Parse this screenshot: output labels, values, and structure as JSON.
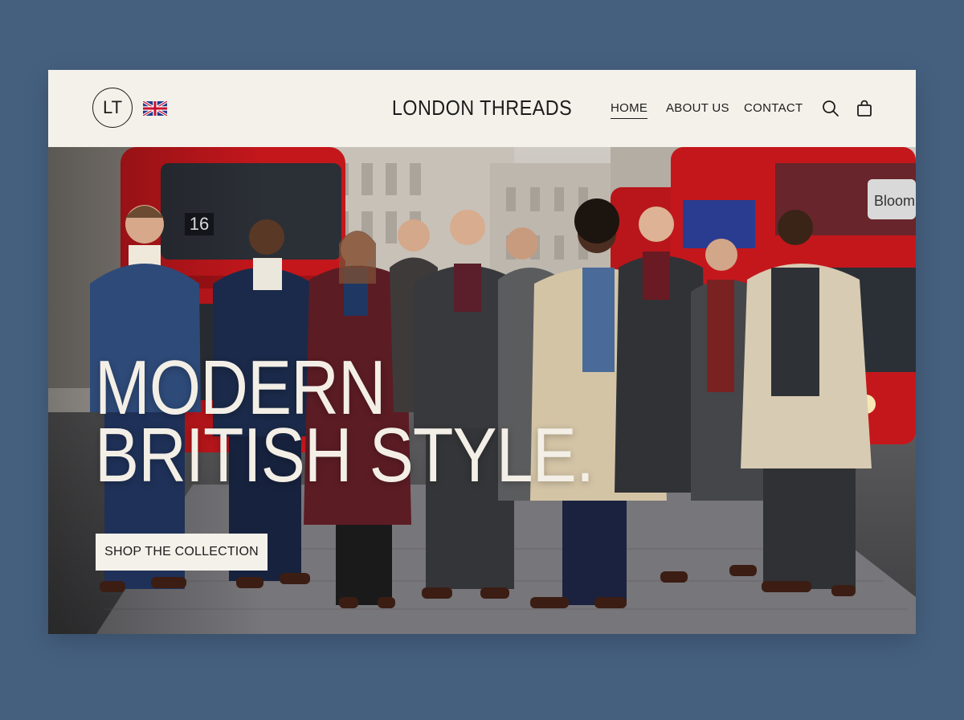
{
  "header": {
    "logo_text": "LT",
    "flag_icon": "uk-flag-icon",
    "brand": "LONDON THREADS",
    "nav": [
      {
        "label": "HOME",
        "active": true
      },
      {
        "label": "ABOUT US",
        "active": false
      },
      {
        "label": "CONTACT",
        "active": false
      }
    ],
    "icons": [
      "search-icon",
      "shopping-bag-icon"
    ]
  },
  "hero": {
    "headline_line1": "MODERN",
    "headline_line2": "BRITISH STYLE.",
    "cta_label": "SHOP THE COLLECTION",
    "bus_number": "16",
    "bus_ad_text": "Bloom"
  },
  "colors": {
    "page_background": "#45607f",
    "header_background": "#f4f1ea",
    "bus_red": "#c4171c",
    "headline_text": "#f3efe6"
  }
}
